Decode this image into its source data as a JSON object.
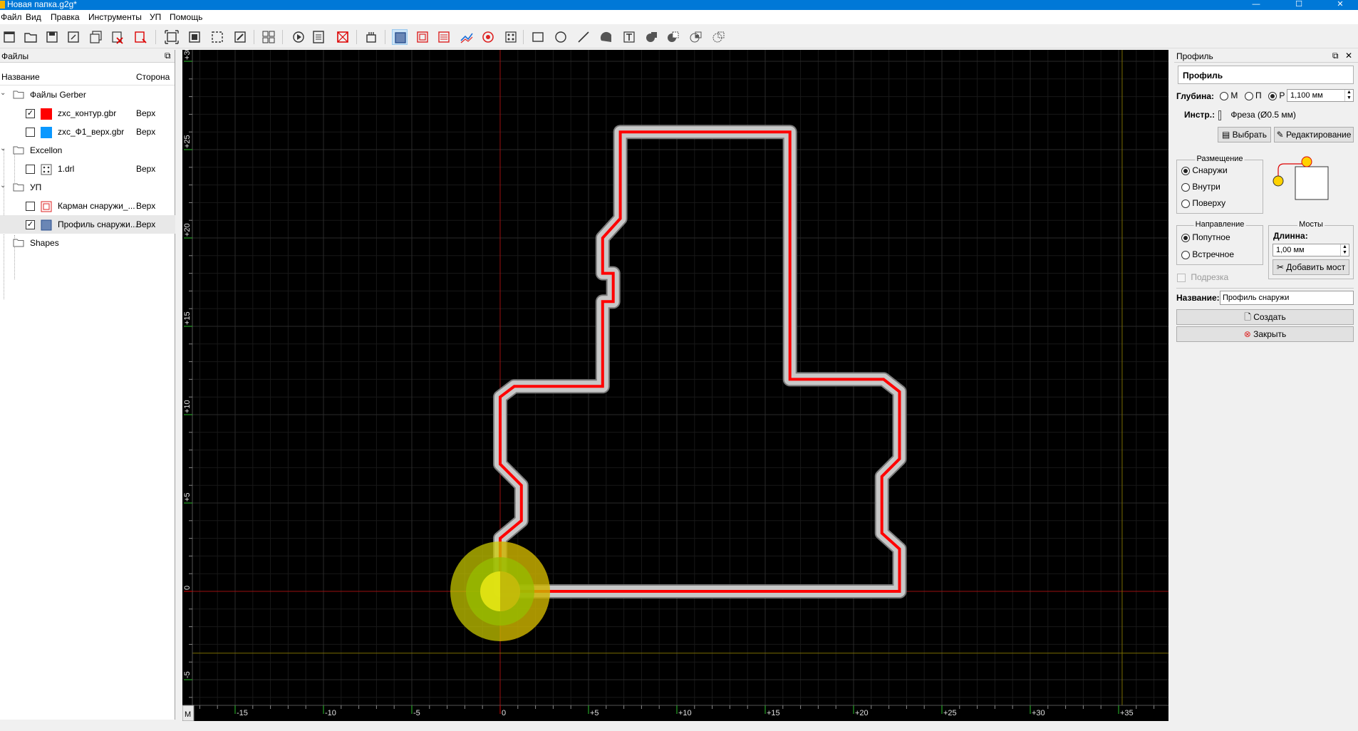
{
  "window": {
    "title": "Новая папка.g2g*",
    "buttons": [
      "—",
      "☐",
      "✕"
    ]
  },
  "menu": [
    "Файл",
    "Вид",
    "Правка",
    "Инструменты",
    "УП",
    "Помощь"
  ],
  "files_panel": {
    "title": "Файлы",
    "col_name": "Название",
    "col_side": "Сторона",
    "tree": [
      {
        "label": "Файлы Gerber",
        "kind": "folder",
        "level": 0
      },
      {
        "label": "zxc_контур.gbr",
        "side": "Верх",
        "kind": "file",
        "checked": true,
        "color": "#ff0000",
        "level": 1
      },
      {
        "label": "zxc_Ф1_верх.gbr",
        "side": "Верх",
        "kind": "file",
        "checked": false,
        "color": "#0a98ff",
        "level": 1
      },
      {
        "label": "Excellon",
        "kind": "folder",
        "level": 0
      },
      {
        "label": "1.drl",
        "side": "Верх",
        "kind": "drill",
        "checked": false,
        "level": 1
      },
      {
        "label": "УП",
        "kind": "folder",
        "level": 0
      },
      {
        "label": "Карман снаружи_...",
        "side": "Верх",
        "kind": "pocket",
        "checked": false,
        "level": 1
      },
      {
        "label": "Профиль снаружи...",
        "side": "Верх",
        "kind": "profile",
        "checked": true,
        "level": 1,
        "selected": true
      },
      {
        "label": "Shapes",
        "kind": "folder",
        "level": 0
      }
    ]
  },
  "canvas": {
    "corner_label": "M",
    "x_ticks": [
      "-15",
      "-10",
      "-5",
      "0",
      "+5",
      "+10",
      "+15",
      "+20",
      "+25",
      "+30",
      "+35"
    ],
    "y_ticks": [
      "+30",
      "+25",
      "+20",
      "+15",
      "+10",
      "+5",
      "0",
      "-5"
    ],
    "colors": {
      "background": "#000000",
      "grid": "#2a2a2a",
      "profile": "#ff0000",
      "toolpath": "#c8c8c8",
      "origin_marker": "#e0e000"
    }
  },
  "profile_panel": {
    "title": "Профиль",
    "header": "Профиль",
    "depth_label": "Глубина:",
    "depth_options": [
      "М",
      "П",
      "Р"
    ],
    "depth_value": "1,100 мм",
    "tool_label": "Инстр.:",
    "tool_value": "Фреза (Ø0.5 мм)",
    "select_button": "Выбрать",
    "edit_button": "Редактирование",
    "placement_title": "Размещение",
    "placement_options": [
      "Снаружи",
      "Внутри",
      "Поверху"
    ],
    "direction_title": "Направление",
    "direction_options": [
      "Попутное",
      "Встречное"
    ],
    "bridges_title": "Мосты",
    "length_label": "Длинна:",
    "length_value": "1,00 мм",
    "add_bridge_button": "Добавить мост",
    "trim_label": "Подрезка",
    "name_label": "Название:",
    "name_value": "Профиль снаружи",
    "create_button": "Создать",
    "close_button": "Закрыть"
  }
}
